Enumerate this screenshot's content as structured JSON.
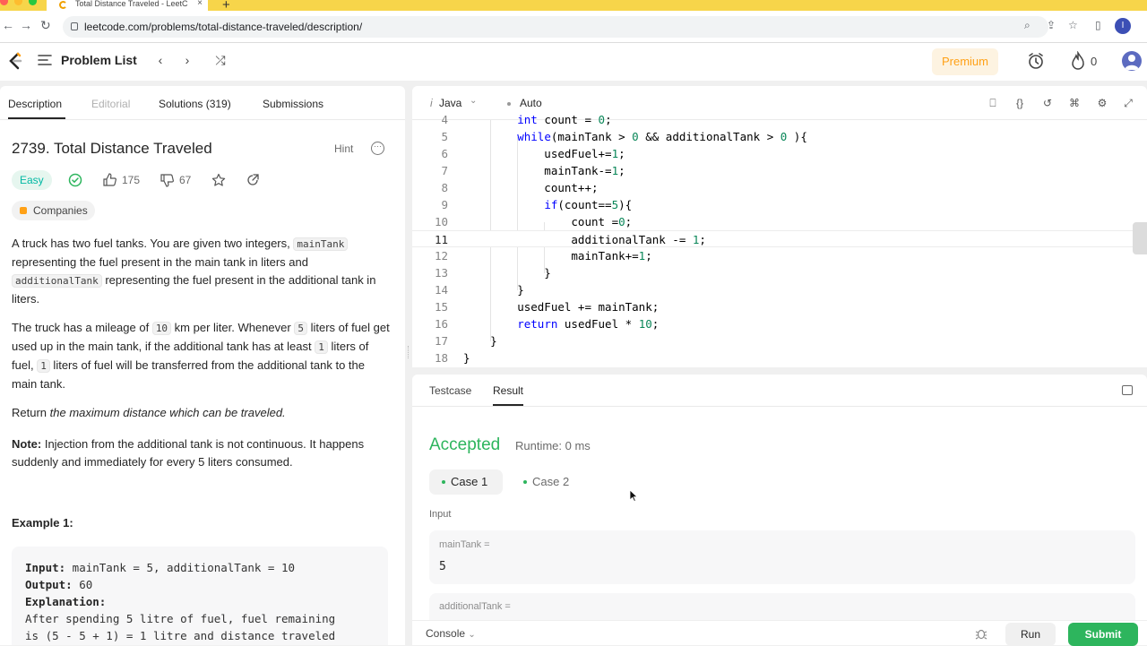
{
  "browser": {
    "tab_title": "Total Distance Traveled - LeetC",
    "tab_close": "×",
    "new_tab": "+",
    "url": "leetcode.com/problems/total-distance-traveled/description/",
    "profile_initial": "I",
    "traffic_colors": [
      "#ff5f57",
      "#febc2e",
      "#28c840"
    ]
  },
  "nav": {
    "problem_list": "Problem List",
    "prev": "‹",
    "next": "›",
    "shuffle": "⤮",
    "premium": "Premium",
    "streak": "0"
  },
  "left": {
    "tabs": [
      "Description",
      "Editorial",
      "Solutions (319)",
      "Submissions"
    ],
    "title": "2739. Total Distance Traveled",
    "hint": "Hint",
    "difficulty": "Easy",
    "likes": "175",
    "dislikes": "67",
    "companies": "Companies",
    "p1": {
      "a": "A truck has two fuel tanks. You are given two integers, ",
      "code1": "mainTank",
      "b": " representing the fuel present in the main tank in liters and ",
      "code2": "additionalTank",
      "c": " representing the fuel present in the additional tank in liters."
    },
    "p2": {
      "a": "The truck has a mileage of ",
      "c1": "10",
      "b": " km per liter. Whenever ",
      "c2": "5",
      "c": " liters of fuel get used up in the main tank, if the additional tank has at least ",
      "c3": "1",
      "d": " liters of fuel, ",
      "c4": "1",
      "e": " liters of fuel will be transferred from the additional tank to the main tank."
    },
    "p3": {
      "a": "Return ",
      "em": "the maximum distance which can be traveled."
    },
    "p4": {
      "strong": "Note:",
      "rest": " Injection from the additional tank is not continuous. It happens suddenly and immediately for every 5 liters consumed."
    },
    "example_heading": "Example 1:",
    "example": {
      "input_label": "Input:",
      "input": " mainTank = 5, additionalTank = 10",
      "output_label": "Output:",
      "output": " 60",
      "explanation_label": "Explanation:",
      "line1": "After spending 5 litre of fuel, fuel remaining",
      "line2": "is (5 - 5 + 1) = 1 litre and distance traveled"
    }
  },
  "editor": {
    "language": "Java",
    "mode": "Auto",
    "lines": [
      {
        "n": "4",
        "t": "        int count = 0;"
      },
      {
        "n": "5",
        "t": "        while(mainTank > 0 && additionalTank > 0 ){"
      },
      {
        "n": "6",
        "t": "            usedFuel+=1;"
      },
      {
        "n": "7",
        "t": "            mainTank-=1;"
      },
      {
        "n": "8",
        "t": "            count++;"
      },
      {
        "n": "9",
        "t": "            if(count==5){"
      },
      {
        "n": "10",
        "t": "                count =0;"
      },
      {
        "n": "11",
        "t": "                additionalTank -= 1;"
      },
      {
        "n": "12",
        "t": "                mainTank+=1;"
      },
      {
        "n": "13",
        "t": "            }"
      },
      {
        "n": "14",
        "t": "        }"
      },
      {
        "n": "15",
        "t": "        usedFuel += mainTank;"
      },
      {
        "n": "16",
        "t": "        return usedFuel * 10;"
      },
      {
        "n": "17",
        "t": "    }"
      },
      {
        "n": "18",
        "t": "}"
      }
    ]
  },
  "result": {
    "tabs": [
      "Testcase",
      "Result"
    ],
    "status": "Accepted",
    "runtime": "Runtime: 0 ms",
    "case1": "Case 1",
    "case2": "Case 2",
    "input_label": "Input",
    "var1_name": "mainTank =",
    "var1_value": "5",
    "var2_name": "additionalTank ="
  },
  "bottom": {
    "console": "Console",
    "run": "Run",
    "submit": "Submit"
  },
  "colors": {
    "accent_green": "#2db55d",
    "easy_teal": "#00b8a3",
    "premium_orange": "#ffa116"
  }
}
